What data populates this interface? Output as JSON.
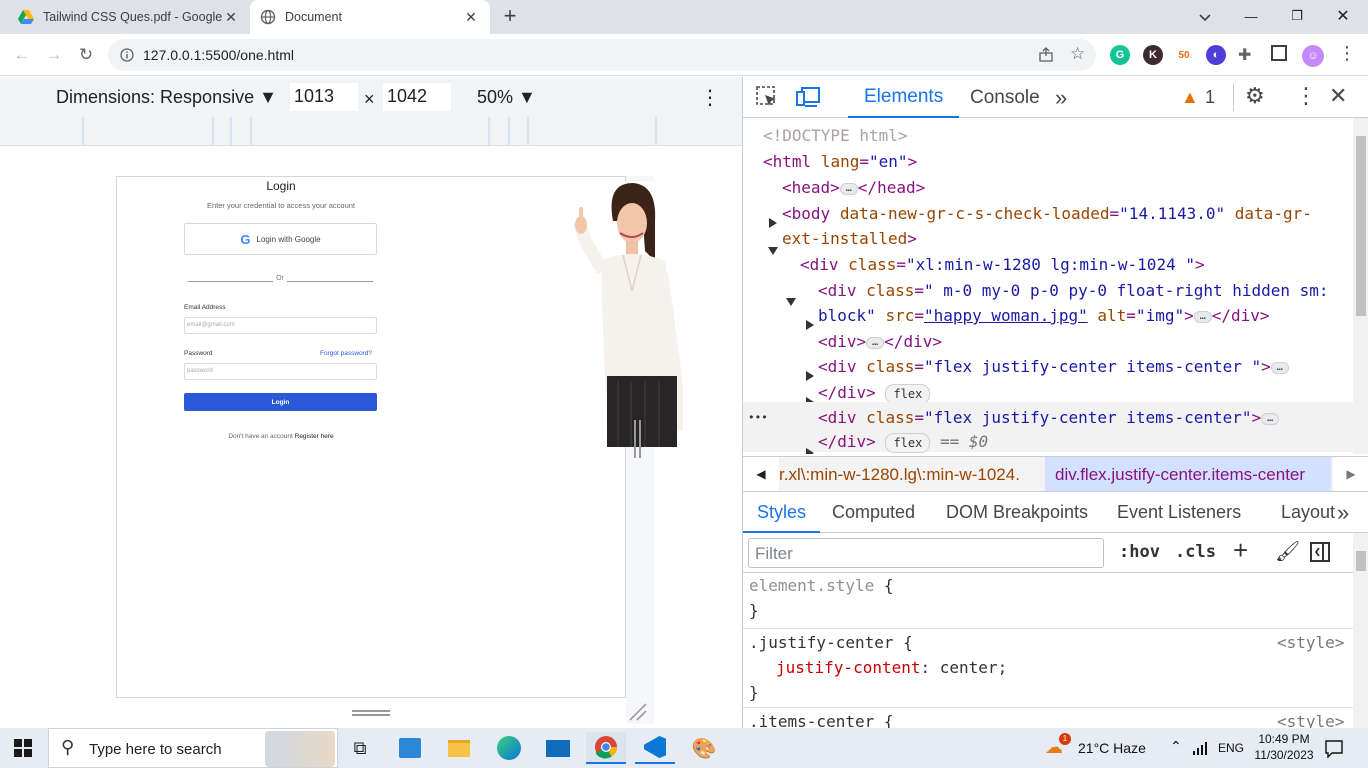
{
  "browser": {
    "tabs": [
      {
        "title": "Tailwind CSS Ques.pdf - Google",
        "close": "✕"
      },
      {
        "title": "Document",
        "close": "✕"
      }
    ],
    "new_tab": "+",
    "window_controls": {
      "minimize": "—",
      "restore": "❐",
      "close": "✕"
    },
    "url": "127.0.0.1:5500/one.html"
  },
  "device_toolbar": {
    "dimensions_label": "Dimensions: Responsive ▼",
    "width": "1013",
    "times": "×",
    "height": "1042",
    "zoom": "50% ▼"
  },
  "page": {
    "title": "Login",
    "subtitle": "Enter your credential to access your account",
    "google_button": "Login with Google",
    "divider": "Or",
    "email_label": "Email Address",
    "email_placeholder": "email@gmail.com",
    "password_label": "Password",
    "forgot": "Forgot password?",
    "password_placeholder": "password",
    "login_button": "Login",
    "no_account": "Don't have an account",
    "register": "Register here"
  },
  "devtools": {
    "tabs": {
      "elements": "Elements",
      "console": "Console",
      "more": "»"
    },
    "issues_count": "1",
    "dom": {
      "doctype": "<!DOCTYPE html>",
      "html_open": "<html",
      "html_attr": "lang",
      "html_val": "\"en\"",
      "head": "<head>",
      "head_close": "</head>",
      "body_open": "<body",
      "body_attr1": "data-new-gr-c-s-check-loaded",
      "body_val1": "\"14.1143.0\"",
      "body_attr2a": "data-gr-",
      "body_attr2b": "ext-installed",
      "div_open": "<div",
      "class_attr": "class",
      "div1_val": "\"xl:min-w-1280 lg:min-w-1024 \"",
      "div2_val_a": "\" m-0 my-0 p-0 py-0 float-right hidden sm:",
      "div2_val_b": "block\"",
      "src_attr": "src",
      "src_val": "\"happy woman.jpg\"",
      "alt_attr": "alt",
      "alt_val": "\"img\"",
      "div_close": "</div>",
      "div3_val": "\"flex justify-center items-center \"",
      "div4_val": "\"flex justify-center items-center\"",
      "flex_badge": "flex",
      "dollar0": "== $0",
      "dots": "•••"
    },
    "breadcrumbs": {
      "first": "r.xl\\:min-w-1280.lg\\:min-w-1024.",
      "second": "div.flex.justify-center.items-center"
    },
    "subtabs": [
      "Styles",
      "Computed",
      "DOM Breakpoints",
      "Event Listeners",
      "Layout"
    ],
    "subtabs_more": "»",
    "filter_placeholder": "Filter",
    "hov": ":hov",
    "cls": ".cls",
    "rules": {
      "element_style": "element.style",
      "open_brace": "{",
      "close_brace": "}",
      "rule1_selector": ".justify-center",
      "rule1_prop": "justify-content",
      "rule1_value": "center;",
      "source": "<style>",
      "rule2_selector": ".items-center"
    }
  },
  "taskbar": {
    "search_placeholder": "Type here to search",
    "weather": "21°C  Haze",
    "weather_badge": "1",
    "lang": "ENG",
    "time": "10:49 PM",
    "date": "11/30/2023"
  },
  "colors": {
    "accent": "#1a73e8",
    "login_button": "#2a59d8",
    "tag": "#881280",
    "attr_name": "#994500",
    "attr_value": "#1a1aa6"
  }
}
